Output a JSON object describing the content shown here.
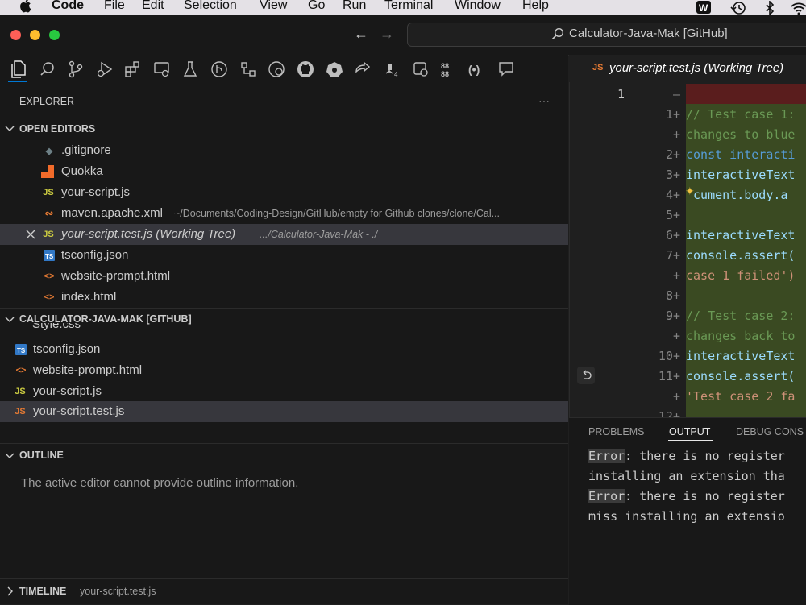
{
  "menubar": {
    "app": "Code",
    "items": [
      "File",
      "Edit",
      "Selection",
      "View",
      "Go",
      "Run",
      "Terminal",
      "Window",
      "Help"
    ]
  },
  "titlebar": {
    "search_text": "Calculator-Java-Mak [GitHub]"
  },
  "explorer": {
    "title": "EXPLORER",
    "more": "···",
    "open_editors": {
      "header": "OPEN EDITORS",
      "items": [
        {
          "name": ".gitignore",
          "icon": "git-file-icon",
          "path": ""
        },
        {
          "name": "Quokka",
          "icon": "quokka-icon",
          "path": ""
        },
        {
          "name": "your-script.js",
          "icon": "js-file-icon",
          "path": ""
        },
        {
          "name": "maven.apache.xml",
          "icon": "rss-file-icon",
          "path": "~/Documents/Coding-Design/GitHub/empty for Github clones/clone/Cal..."
        },
        {
          "name": "your-script.test.js (Working Tree)",
          "icon": "js-file-icon",
          "path": ".../Calculator-Java-Mak - ./"
        },
        {
          "name": "tsconfig.json",
          "icon": "ts-file-icon",
          "path": ""
        },
        {
          "name": "website-prompt.html",
          "icon": "html-file-icon",
          "path": ""
        },
        {
          "name": "index.html",
          "icon": "html-file-icon",
          "path": ""
        }
      ]
    },
    "folder": {
      "header": "CALCULATOR-JAVA-MAK [GITHUB]",
      "partial_item": "Style.css",
      "items": [
        {
          "name": "tsconfig.json",
          "icon": "ts-file-icon"
        },
        {
          "name": "website-prompt.html",
          "icon": "html-file-icon"
        },
        {
          "name": "your-script.js",
          "icon": "js-file-icon"
        },
        {
          "name": "your-script.test.js",
          "icon": "js-file-icon"
        }
      ]
    },
    "outline": {
      "header": "OUTLINE",
      "message": "The active editor cannot provide outline information."
    },
    "timeline": {
      "header": "TIMELINE",
      "file": "your-script.test.js"
    }
  },
  "editor": {
    "tab_label": "your-script.test.js (Working Tree)",
    "left_line_number": "1",
    "lines": [
      {
        "num": "—",
        "text": "",
        "kind": "deleted"
      },
      {
        "num": "1+",
        "text": "// Test case 1:",
        "kind": "comment"
      },
      {
        "num": "+",
        "text": "changes to blue",
        "kind": "comment"
      },
      {
        "num": "2+",
        "text": "const interacti",
        "kind": "const"
      },
      {
        "num": "3+",
        "text": "interactiveText",
        "kind": "ident"
      },
      {
        "num": "4+",
        "text": " cument.body.a",
        "kind": "ident"
      },
      {
        "num": "5+",
        "text": "",
        "kind": "blank"
      },
      {
        "num": "6+",
        "text": "interactiveText",
        "kind": "ident"
      },
      {
        "num": "7+",
        "text": "console.assert(",
        "kind": "ident"
      },
      {
        "num": "+",
        "text": "case 1 failed')",
        "kind": "string"
      },
      {
        "num": "8+",
        "text": "",
        "kind": "blank"
      },
      {
        "num": "9+",
        "text": "// Test case 2:",
        "kind": "comment"
      },
      {
        "num": "+",
        "text": "changes back to",
        "kind": "comment"
      },
      {
        "num": "10+",
        "text": "interactiveText",
        "kind": "ident"
      },
      {
        "num": "11+",
        "text": "console.assert(",
        "kind": "ident"
      },
      {
        "num": "+",
        "text": "'Test case 2 fa",
        "kind": "string"
      },
      {
        "num": "12+",
        "text": "",
        "kind": "blank"
      }
    ]
  },
  "panel": {
    "tabs": [
      "PROBLEMS",
      "OUTPUT",
      "DEBUG CONS"
    ],
    "active_tab": "OUTPUT",
    "output_lines": [
      {
        "hl": "Error",
        "rest": ": there is no register"
      },
      {
        "hl": "",
        "rest": "installing an extension tha"
      },
      {
        "hl": "Error",
        "rest": ": there is no register"
      },
      {
        "hl": "",
        "rest": "miss installing an extensio"
      }
    ]
  },
  "colors": {
    "accent": "#0078d4",
    "js": "#cbcb41",
    "ts": "#3178c6",
    "html": "#e37933",
    "quokka": "#f26b2a",
    "diff_added": "#3a4a22",
    "diff_deleted": "#5a1d1d"
  }
}
